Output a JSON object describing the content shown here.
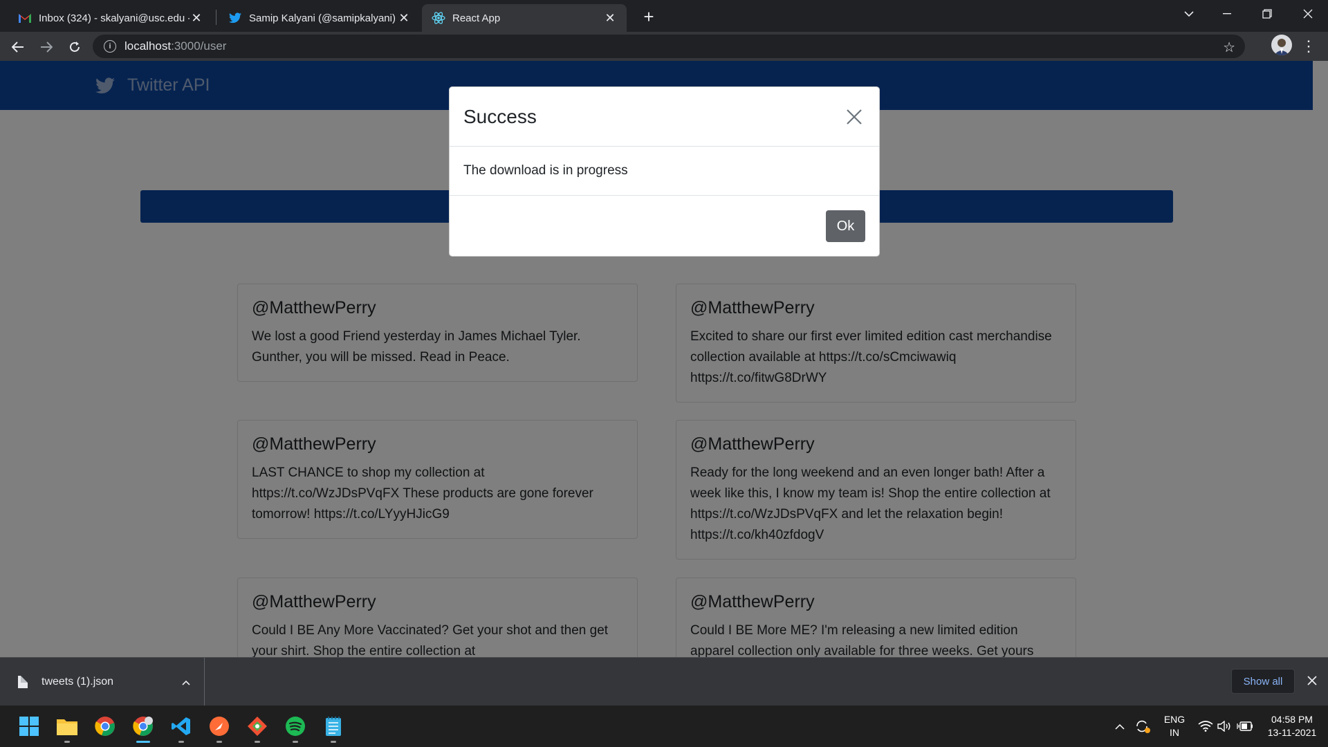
{
  "browser": {
    "tabs": [
      {
        "title": "Inbox (324) - skalyani@usc.edu -",
        "icon": "gmail-icon"
      },
      {
        "title": "Samip Kalyani (@samipkalyani) /",
        "icon": "twitter-icon"
      },
      {
        "title": "React App",
        "icon": "react-icon"
      }
    ],
    "new_tab": "+",
    "url_host": "localhost",
    "url_path": ":3000/user"
  },
  "app": {
    "brand": "Twitter API"
  },
  "tweets": [
    {
      "handle": "@MatthewPerry",
      "text": "We lost a good Friend yesterday in James Michael Tyler. Gunther, you will be missed. Read in Peace."
    },
    {
      "handle": "@MatthewPerry",
      "text": "Excited to share our first ever limited edition cast merchandise collection available at https://t.co/sCmciwawiq https://t.co/fitwG8DrWY"
    },
    {
      "handle": "@MatthewPerry",
      "text": "LAST CHANCE to shop my collection at https://t.co/WzJDsPVqFX These products are gone forever tomorrow! https://t.co/LYyyHJicG9"
    },
    {
      "handle": "@MatthewPerry",
      "text": "Ready for the long weekend and an even longer bath! After a week like this, I know my team is! Shop the entire collection at https://t.co/WzJDsPVqFX and let the relaxation begin! https://t.co/kh40zfdogV"
    },
    {
      "handle": "@MatthewPerry",
      "text": "Could I BE Any More Vaccinated? Get your shot and then get your shirt. Shop the entire collection at"
    },
    {
      "handle": "@MatthewPerry",
      "text": "Could I BE More ME? I'm releasing a new limited edition apparel collection only available for three weeks. Get yours"
    }
  ],
  "modal": {
    "title": "Success",
    "body": "The download is in progress",
    "ok_label": "Ok"
  },
  "downloads": {
    "file_name": "tweets (1).json",
    "show_all": "Show all"
  },
  "taskbar": {
    "lang_top": "ENG",
    "lang_bottom": "IN",
    "time": "04:58 PM",
    "date": "13-11-2021"
  },
  "colors": {
    "app_blue": "#0d47a1",
    "ok_button": "#5f6368",
    "link_blue": "#8ab4f8"
  }
}
